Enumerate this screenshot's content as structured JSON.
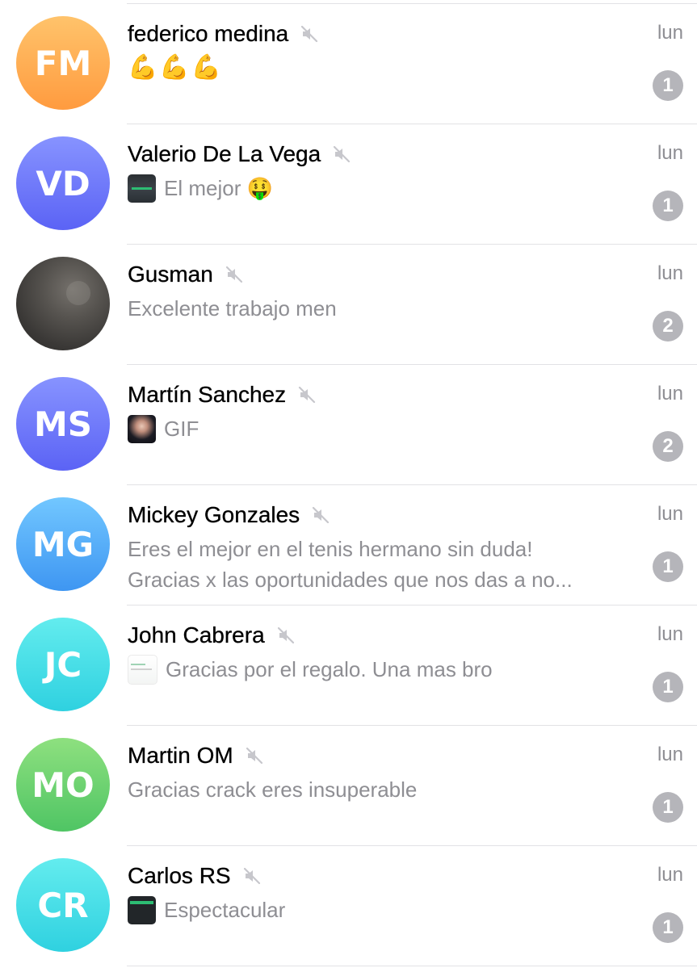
{
  "colors": {
    "separator": "#e2e2e5",
    "secondary_text": "#8e8e93",
    "badge_muted": "#b5b5ba"
  },
  "chats": [
    {
      "initials": "FM",
      "avatar_gradient": [
        "#ffc36b",
        "#ff9b3f"
      ],
      "name": "federico medina",
      "muted": true,
      "time": "lun",
      "preview": "💪💪💪",
      "preview_type": "emoji",
      "unread": "1"
    },
    {
      "initials": "VD",
      "avatar_gradient": [
        "#8793ff",
        "#5b63f5"
      ],
      "name": "Valerio De La Vega",
      "muted": true,
      "time": "lun",
      "preview": "El mejor 🤑",
      "preview_type": "media",
      "thumb": "dark",
      "unread": "1"
    },
    {
      "initials": "",
      "avatar_type": "photo",
      "name": "Gusman",
      "muted": true,
      "time": "lun",
      "preview": "Excelente trabajo men",
      "preview_type": "text",
      "unread": "2"
    },
    {
      "initials": "MS",
      "avatar_gradient": [
        "#8793ff",
        "#5b63f5"
      ],
      "name": "Martín Sanchez",
      "muted": true,
      "time": "lun",
      "preview": "GIF",
      "preview_type": "media",
      "thumb": "gif",
      "unread": "2"
    },
    {
      "initials": "MG",
      "avatar_gradient": [
        "#72c7ff",
        "#3e96f2"
      ],
      "name": "Mickey Gonzales",
      "muted": true,
      "time": "lun",
      "preview_lines": [
        "Eres el mejor en el tenis hermano sin duda!",
        "Gracias x las oportunidades que nos das a no..."
      ],
      "preview_type": "two-line",
      "unread": "1"
    },
    {
      "initials": "JC",
      "avatar_gradient": [
        "#63ecee",
        "#2fd1e0"
      ],
      "name": "John Cabrera",
      "muted": true,
      "time": "lun",
      "preview": "Gracias por el regalo. Una mas bro",
      "preview_type": "media",
      "thumb": "doc",
      "unread": "1"
    },
    {
      "initials": "MO",
      "avatar_gradient": [
        "#8ee07f",
        "#4fc564"
      ],
      "name": "Martin OM",
      "muted": true,
      "time": "lun",
      "preview": "Gracias crack eres insuperable",
      "preview_type": "text",
      "unread": "1"
    },
    {
      "initials": "CR",
      "avatar_gradient": [
        "#63ecee",
        "#2fd1e0"
      ],
      "name": "Carlos RS",
      "muted": true,
      "time": "lun",
      "preview": "Espectacular",
      "preview_type": "media",
      "thumb": "black",
      "unread": "1"
    }
  ]
}
